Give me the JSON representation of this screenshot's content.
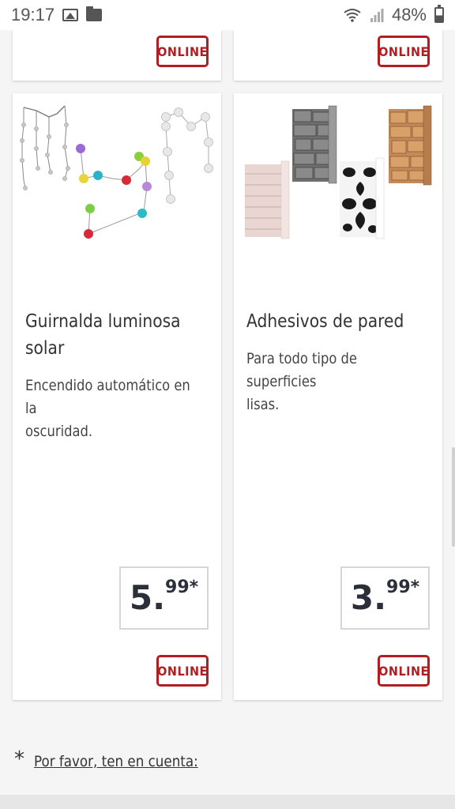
{
  "status_bar": {
    "time": "19:17",
    "battery": "48%"
  },
  "top_cards": [
    {
      "badge": "ONLINE"
    },
    {
      "badge": "ONLINE"
    }
  ],
  "products": [
    {
      "title_line1": "Guirnalda luminosa",
      "title_line2": "solar",
      "desc_line1": "Encendido automático en la",
      "desc_line2": "oscuridad.",
      "price_main": "5.",
      "price_cents": "99*",
      "badge": "ONLINE",
      "image": "string-lights-image"
    },
    {
      "title_line1": "Adhesivos de pared",
      "title_line2": "",
      "desc_line1": "Para todo tipo de superficies",
      "desc_line2": "lisas.",
      "price_main": "3.",
      "price_cents": "99*",
      "badge": "ONLINE",
      "image": "wallpaper-rolls-image"
    }
  ],
  "footer": {
    "asterisk": "*",
    "note_link": "Por favor, ten en cuenta:"
  },
  "colors": {
    "online_red": "#b01e23",
    "price_text": "#2b2f3a",
    "background": "#f5f5f5"
  }
}
